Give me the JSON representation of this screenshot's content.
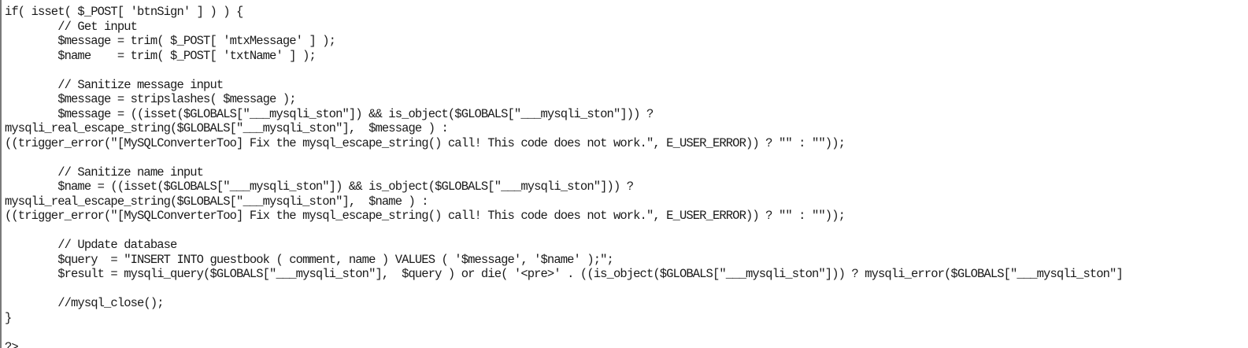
{
  "code_lines": [
    "if( isset( $_POST[ 'btnSign' ] ) ) {",
    "        // Get input",
    "        $message = trim( $_POST[ 'mtxMessage' ] );",
    "        $name    = trim( $_POST[ 'txtName' ] );",
    "",
    "        // Sanitize message input",
    "        $message = stripslashes( $message );",
    "        $message = ((isset($GLOBALS[\"___mysqli_ston\"]) && is_object($GLOBALS[\"___mysqli_ston\"])) ?",
    "mysqli_real_escape_string($GLOBALS[\"___mysqli_ston\"],  $message ) :",
    "((trigger_error(\"[MySQLConverterToo] Fix the mysql_escape_string() call! This code does not work.\", E_USER_ERROR)) ? \"\" : \"\"));",
    "",
    "        // Sanitize name input",
    "        $name = ((isset($GLOBALS[\"___mysqli_ston\"]) && is_object($GLOBALS[\"___mysqli_ston\"])) ?",
    "mysqli_real_escape_string($GLOBALS[\"___mysqli_ston\"],  $name ) :",
    "((trigger_error(\"[MySQLConverterToo] Fix the mysql_escape_string() call! This code does not work.\", E_USER_ERROR)) ? \"\" : \"\"));",
    "",
    "        // Update database",
    "        $query  = \"INSERT INTO guestbook ( comment, name ) VALUES ( '$message', '$name' );\";",
    "        $result = mysqli_query($GLOBALS[\"___mysqli_ston\"],  $query ) or die( '<pre>' . ((is_object($GLOBALS[\"___mysqli_ston\"])) ? mysqli_error($GLOBALS[\"___mysqli_ston\"]",
    "",
    "        //mysql_close();",
    "}",
    "",
    "?>"
  ]
}
